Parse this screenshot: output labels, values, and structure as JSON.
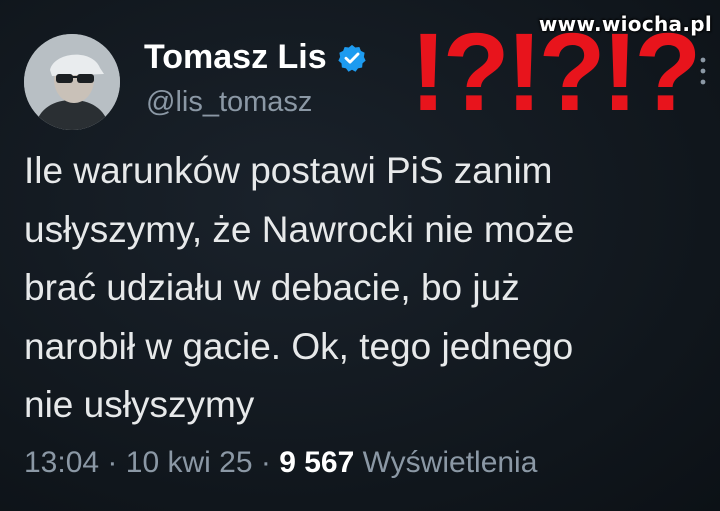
{
  "watermark": "www.wiocha.pl",
  "tweet": {
    "display_name": "Tomasz Lis",
    "handle": "@lis_tomasz",
    "verified_icon": "verified-badge-icon",
    "overlay_text": "!?!?!?",
    "text": "Ile warunków postawi PiS zanim\nusłyszymy, że Nawrocki nie może\nbrać udziału w debacie, bo już\nnarobił w gacie. Ok, tego jednego\nnie usłyszymy",
    "time": "13:04",
    "separator": "·",
    "date": "10 kwi 25",
    "views_count": "9 567",
    "views_label": "Wyświetlenia"
  },
  "colors": {
    "background": "#0f1419",
    "primary_text": "#e7e9ea",
    "secondary_text": "#8b98a5",
    "verified_blue": "#1d9bf0",
    "overlay_red": "#e8141c"
  }
}
